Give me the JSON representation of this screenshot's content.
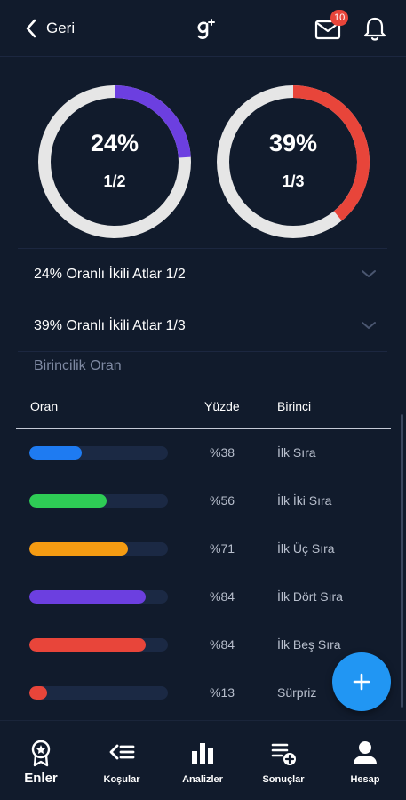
{
  "header": {
    "back_label": "Geri",
    "mail_badge": "10",
    "logo_icon": "brand-g-logo",
    "mail_icon": "mail-icon",
    "bell_icon": "bell-icon"
  },
  "donuts": [
    {
      "percent_label": "24%",
      "fraction_label": "1/2",
      "fill_fraction": 0.24,
      "color": "#6c3fe0"
    },
    {
      "percent_label": "39%",
      "fraction_label": "1/3",
      "fill_fraction": 0.39,
      "color": "#e8453a"
    }
  ],
  "accordions": [
    {
      "label": "24% Oranlı İkili Atlar 1/2"
    },
    {
      "label": "39% Oranlı İkili Atlar 1/3"
    }
  ],
  "section_title": "Birincilik Oran",
  "table": {
    "headers": {
      "ratio": "Oran",
      "percent": "Yüzde",
      "first": "Birinci"
    },
    "rows": [
      {
        "percent_label": "%38",
        "name": "İlk Sıra",
        "fill": 0.38,
        "color": "#1e7bf2"
      },
      {
        "percent_label": "%56",
        "name": "İlk İki Sıra",
        "fill": 0.56,
        "color": "#2ecc55"
      },
      {
        "percent_label": "%71",
        "name": "İlk Üç Sıra",
        "fill": 0.71,
        "color": "#f59b12"
      },
      {
        "percent_label": "%84",
        "name": "İlk Dört Sıra",
        "fill": 0.84,
        "color": "#6c3fe0"
      },
      {
        "percent_label": "%84",
        "name": "İlk Beş Sıra",
        "fill": 0.84,
        "color": "#e8453a"
      },
      {
        "percent_label": "%13",
        "name": "Sürpriz",
        "fill": 0.13,
        "color": "#e8453a"
      }
    ]
  },
  "fab": {
    "icon": "plus-icon"
  },
  "tabs": [
    {
      "label": "Enler",
      "icon": "award-icon",
      "active": true
    },
    {
      "label": "Koşular",
      "icon": "list-back-icon",
      "active": false
    },
    {
      "label": "Analizler",
      "icon": "bar-chart-icon",
      "active": false
    },
    {
      "label": "Sonuçlar",
      "icon": "list-add-icon",
      "active": false
    },
    {
      "label": "Hesap",
      "icon": "person-icon",
      "active": false
    }
  ],
  "colors": {
    "background": "#111b2c",
    "track": "#1b2944",
    "accent": "#2196f3"
  }
}
